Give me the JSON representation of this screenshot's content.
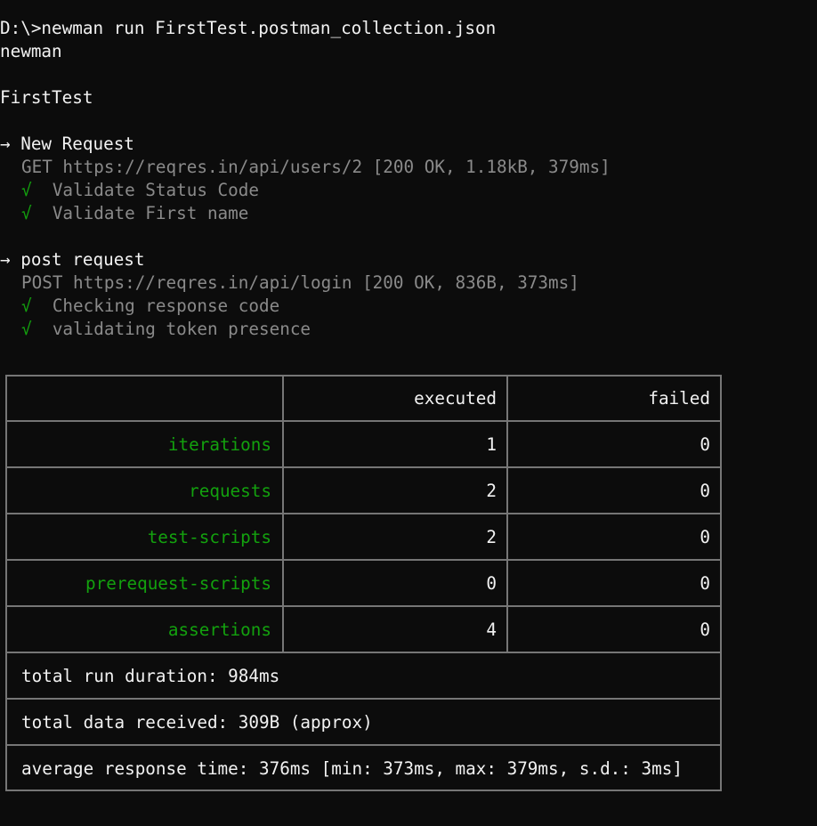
{
  "colors": {
    "background": "#0c0c0c",
    "text": "#cccccc",
    "bright_text": "#f2f2f2",
    "dim_text": "#8a8a8a",
    "pass_green": "#13a10e",
    "table_border": "#767676"
  },
  "terminal": {
    "command_line": "D:\\>newman run FirstTest.postman_collection.json",
    "tool_name": "newman",
    "collection_name": "FirstTest",
    "requests": [
      {
        "arrow": "→",
        "name": "New Request",
        "detail": "GET https://reqres.in/api/users/2 [200 OK, 1.18kB, 379ms]",
        "assertions": [
          {
            "mark": "√",
            "label": "Validate Status Code"
          },
          {
            "mark": "√",
            "label": "Validate First name"
          }
        ]
      },
      {
        "arrow": "→",
        "name": "post request",
        "detail": "POST https://reqres.in/api/login [200 OK, 836B, 373ms]",
        "assertions": [
          {
            "mark": "√",
            "label": "Checking response code"
          },
          {
            "mark": "√",
            "label": "validating token presence"
          }
        ]
      }
    ]
  },
  "summary": {
    "headers": [
      "",
      "executed",
      "failed"
    ],
    "rows": [
      {
        "label": "iterations",
        "executed": "1",
        "failed": "0"
      },
      {
        "label": "requests",
        "executed": "2",
        "failed": "0"
      },
      {
        "label": "test-scripts",
        "executed": "2",
        "failed": "0"
      },
      {
        "label": "prerequest-scripts",
        "executed": "0",
        "failed": "0"
      },
      {
        "label": "assertions",
        "executed": "4",
        "failed": "0"
      }
    ],
    "total_run_duration": "total run duration: 984ms",
    "total_data_received": "total data received: 309B (approx)",
    "average_response_time": "average response time: 376ms [min: 373ms, max: 379ms, s.d.: 3ms]"
  }
}
